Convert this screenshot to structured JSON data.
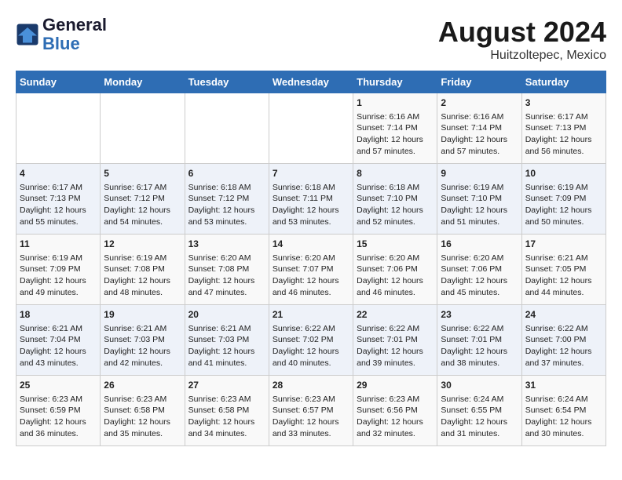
{
  "header": {
    "logo_line1": "General",
    "logo_line2": "Blue",
    "month_year": "August 2024",
    "location": "Huitzoltepec, Mexico"
  },
  "days_of_week": [
    "Sunday",
    "Monday",
    "Tuesday",
    "Wednesday",
    "Thursday",
    "Friday",
    "Saturday"
  ],
  "weeks": [
    [
      {
        "day": "",
        "content": ""
      },
      {
        "day": "",
        "content": ""
      },
      {
        "day": "",
        "content": ""
      },
      {
        "day": "",
        "content": ""
      },
      {
        "day": "1",
        "content": "Sunrise: 6:16 AM\nSunset: 7:14 PM\nDaylight: 12 hours\nand 57 minutes."
      },
      {
        "day": "2",
        "content": "Sunrise: 6:16 AM\nSunset: 7:14 PM\nDaylight: 12 hours\nand 57 minutes."
      },
      {
        "day": "3",
        "content": "Sunrise: 6:17 AM\nSunset: 7:13 PM\nDaylight: 12 hours\nand 56 minutes."
      }
    ],
    [
      {
        "day": "4",
        "content": "Sunrise: 6:17 AM\nSunset: 7:13 PM\nDaylight: 12 hours\nand 55 minutes."
      },
      {
        "day": "5",
        "content": "Sunrise: 6:17 AM\nSunset: 7:12 PM\nDaylight: 12 hours\nand 54 minutes."
      },
      {
        "day": "6",
        "content": "Sunrise: 6:18 AM\nSunset: 7:12 PM\nDaylight: 12 hours\nand 53 minutes."
      },
      {
        "day": "7",
        "content": "Sunrise: 6:18 AM\nSunset: 7:11 PM\nDaylight: 12 hours\nand 53 minutes."
      },
      {
        "day": "8",
        "content": "Sunrise: 6:18 AM\nSunset: 7:10 PM\nDaylight: 12 hours\nand 52 minutes."
      },
      {
        "day": "9",
        "content": "Sunrise: 6:19 AM\nSunset: 7:10 PM\nDaylight: 12 hours\nand 51 minutes."
      },
      {
        "day": "10",
        "content": "Sunrise: 6:19 AM\nSunset: 7:09 PM\nDaylight: 12 hours\nand 50 minutes."
      }
    ],
    [
      {
        "day": "11",
        "content": "Sunrise: 6:19 AM\nSunset: 7:09 PM\nDaylight: 12 hours\nand 49 minutes."
      },
      {
        "day": "12",
        "content": "Sunrise: 6:19 AM\nSunset: 7:08 PM\nDaylight: 12 hours\nand 48 minutes."
      },
      {
        "day": "13",
        "content": "Sunrise: 6:20 AM\nSunset: 7:08 PM\nDaylight: 12 hours\nand 47 minutes."
      },
      {
        "day": "14",
        "content": "Sunrise: 6:20 AM\nSunset: 7:07 PM\nDaylight: 12 hours\nand 46 minutes."
      },
      {
        "day": "15",
        "content": "Sunrise: 6:20 AM\nSunset: 7:06 PM\nDaylight: 12 hours\nand 46 minutes."
      },
      {
        "day": "16",
        "content": "Sunrise: 6:20 AM\nSunset: 7:06 PM\nDaylight: 12 hours\nand 45 minutes."
      },
      {
        "day": "17",
        "content": "Sunrise: 6:21 AM\nSunset: 7:05 PM\nDaylight: 12 hours\nand 44 minutes."
      }
    ],
    [
      {
        "day": "18",
        "content": "Sunrise: 6:21 AM\nSunset: 7:04 PM\nDaylight: 12 hours\nand 43 minutes."
      },
      {
        "day": "19",
        "content": "Sunrise: 6:21 AM\nSunset: 7:03 PM\nDaylight: 12 hours\nand 42 minutes."
      },
      {
        "day": "20",
        "content": "Sunrise: 6:21 AM\nSunset: 7:03 PM\nDaylight: 12 hours\nand 41 minutes."
      },
      {
        "day": "21",
        "content": "Sunrise: 6:22 AM\nSunset: 7:02 PM\nDaylight: 12 hours\nand 40 minutes."
      },
      {
        "day": "22",
        "content": "Sunrise: 6:22 AM\nSunset: 7:01 PM\nDaylight: 12 hours\nand 39 minutes."
      },
      {
        "day": "23",
        "content": "Sunrise: 6:22 AM\nSunset: 7:01 PM\nDaylight: 12 hours\nand 38 minutes."
      },
      {
        "day": "24",
        "content": "Sunrise: 6:22 AM\nSunset: 7:00 PM\nDaylight: 12 hours\nand 37 minutes."
      }
    ],
    [
      {
        "day": "25",
        "content": "Sunrise: 6:23 AM\nSunset: 6:59 PM\nDaylight: 12 hours\nand 36 minutes."
      },
      {
        "day": "26",
        "content": "Sunrise: 6:23 AM\nSunset: 6:58 PM\nDaylight: 12 hours\nand 35 minutes."
      },
      {
        "day": "27",
        "content": "Sunrise: 6:23 AM\nSunset: 6:58 PM\nDaylight: 12 hours\nand 34 minutes."
      },
      {
        "day": "28",
        "content": "Sunrise: 6:23 AM\nSunset: 6:57 PM\nDaylight: 12 hours\nand 33 minutes."
      },
      {
        "day": "29",
        "content": "Sunrise: 6:23 AM\nSunset: 6:56 PM\nDaylight: 12 hours\nand 32 minutes."
      },
      {
        "day": "30",
        "content": "Sunrise: 6:24 AM\nSunset: 6:55 PM\nDaylight: 12 hours\nand 31 minutes."
      },
      {
        "day": "31",
        "content": "Sunrise: 6:24 AM\nSunset: 6:54 PM\nDaylight: 12 hours\nand 30 minutes."
      }
    ]
  ]
}
